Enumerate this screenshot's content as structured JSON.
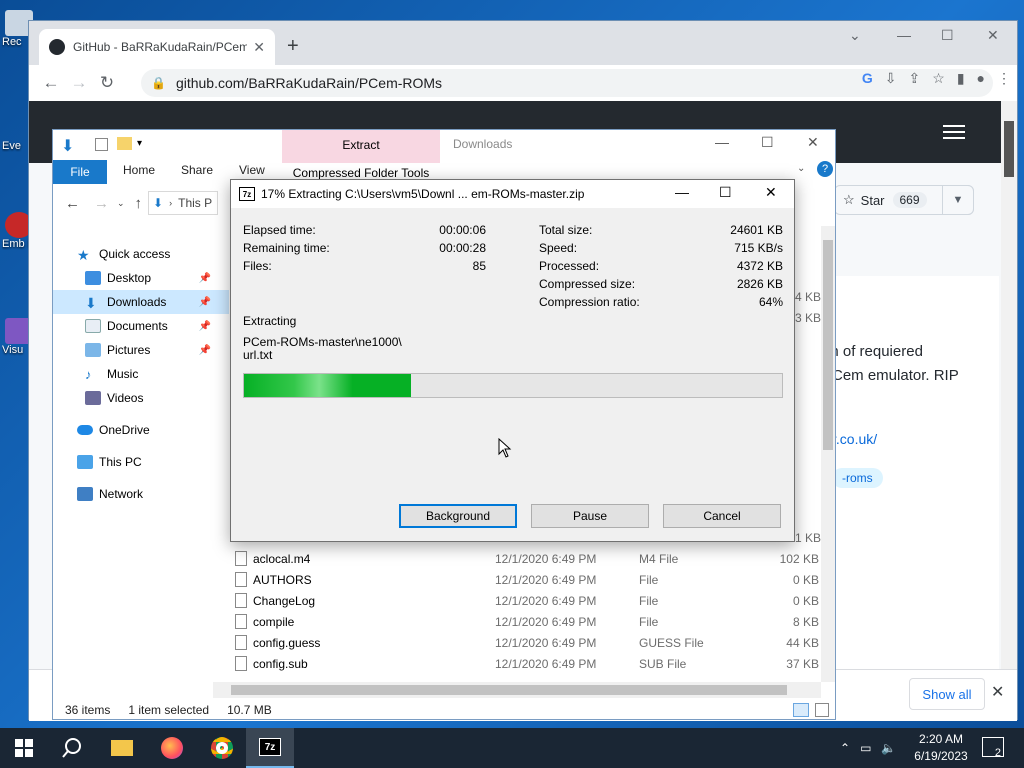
{
  "desktop": {
    "icons": [
      {
        "label": "Rec"
      },
      {
        "label": "Eve"
      },
      {
        "label": "Emb De"
      },
      {
        "label": "Visu"
      }
    ]
  },
  "chrome": {
    "tab_title": "GitHub - BaRRaKudaRain/PCem-",
    "url": "github.com/BaRRaKudaRain/PCem-ROMs",
    "star_label": "Star",
    "star_count": "669",
    "desc_line1": "on of requiered",
    "desc_line2": "Cem emulator. RIP",
    "link_text": "r.co.uk/",
    "topic": "-roms",
    "show_all": "Show all"
  },
  "explorer": {
    "ribbon": {
      "file": "File",
      "home": "Home",
      "share": "Share",
      "view": "View",
      "extract": "Extract",
      "context_tab": "Compressed Folder Tools",
      "window_title": "Downloads"
    },
    "address": "This P",
    "nav": [
      {
        "label": "Quick access"
      },
      {
        "label": "Desktop"
      },
      {
        "label": "Downloads"
      },
      {
        "label": "Documents"
      },
      {
        "label": "Pictures"
      },
      {
        "label": "Music"
      },
      {
        "label": "Videos"
      },
      {
        "label": "OneDrive"
      },
      {
        "label": "This PC"
      },
      {
        "label": "Network"
      }
    ],
    "right_sizes": [
      "4 KB",
      "3 KB",
      "1 KB"
    ],
    "files": [
      {
        "name": "aclocal.m4",
        "date": "12/1/2020 6:49 PM",
        "type": "M4 File",
        "size": "102 KB"
      },
      {
        "name": "AUTHORS",
        "date": "12/1/2020 6:49 PM",
        "type": "File",
        "size": "0 KB"
      },
      {
        "name": "ChangeLog",
        "date": "12/1/2020 6:49 PM",
        "type": "File",
        "size": "0 KB"
      },
      {
        "name": "compile",
        "date": "12/1/2020 6:49 PM",
        "type": "File",
        "size": "8 KB"
      },
      {
        "name": "config.guess",
        "date": "12/1/2020 6:49 PM",
        "type": "GUESS File",
        "size": "44 KB"
      },
      {
        "name": "config.sub",
        "date": "12/1/2020 6:49 PM",
        "type": "SUB File",
        "size": "37 KB"
      }
    ],
    "status": {
      "items": "36 items",
      "selected": "1 item selected",
      "size": "10.7 MB"
    }
  },
  "sevenzip": {
    "title": "17% Extracting C:\\Users\\vm5\\Downl ... em-ROMs-master.zip",
    "left": [
      {
        "label": "Elapsed time:",
        "value": "00:00:06"
      },
      {
        "label": "Remaining time:",
        "value": "00:00:28"
      },
      {
        "label": "Files:",
        "value": "85"
      }
    ],
    "right": [
      {
        "label": "Total size:",
        "value": "24601 KB"
      },
      {
        "label": "Speed:",
        "value": "715 KB/s"
      },
      {
        "label": "Processed:",
        "value": "4372 KB"
      },
      {
        "label": "Compressed size:",
        "value": "2826 KB"
      },
      {
        "label": "Compression ratio:",
        "value": "64%"
      }
    ],
    "action": "Extracting",
    "path_line1": "PCem-ROMs-master\\ne1000\\",
    "path_line2": "url.txt",
    "progress_fraction": 0.31,
    "buttons": {
      "background": "Background",
      "pause": "Pause",
      "cancel": "Cancel"
    }
  },
  "taskbar": {
    "time": "2:20 AM",
    "date": "6/19/2023",
    "notification_count": "2"
  },
  "colors": {
    "accent": "#0078d7",
    "progress": "#06b025",
    "github_header": "#24292f"
  }
}
